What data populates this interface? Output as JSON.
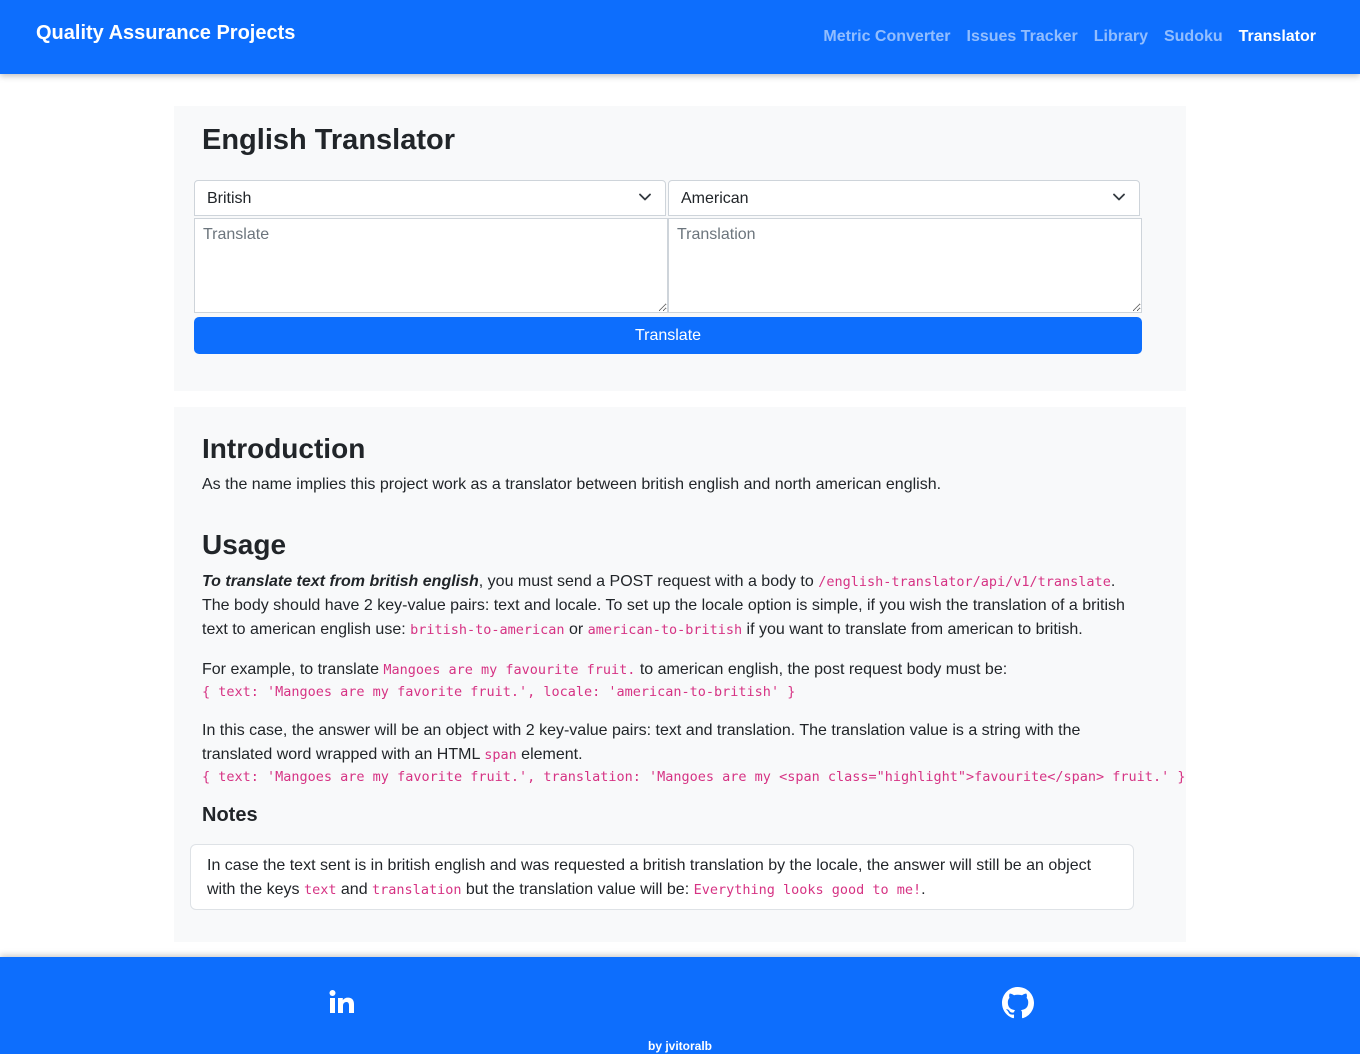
{
  "navbar": {
    "brand": "Quality Assurance Projects",
    "links": [
      "Metric Converter",
      "Issues Tracker",
      "Library",
      "Sudoku",
      "Translator"
    ],
    "active": "Translator"
  },
  "translator": {
    "title": "English Translator",
    "from_locale": "British",
    "to_locale": "American",
    "input_placeholder": "Translate",
    "output_placeholder": "Translation",
    "button_label": "Translate"
  },
  "docs": {
    "intro_title": "Introduction",
    "intro_text": "As the name implies this project work as a translator between british english and north american english.",
    "usage_title": "Usage",
    "usage": {
      "emphasis": "To translate text from british english",
      "t1": ", you must send a POST request with a body to ",
      "endpoint": "/english-translator/api/v1/translate",
      "t2": ". The body should have 2 key-value pairs: text and locale. To set up the locale option is simple, if you wish the translation of a british text to american english use: ",
      "code_b2a": "british-to-american",
      "t3": " or ",
      "code_a2b": "american-to-british",
      "t4": " if you want to translate from american to british."
    },
    "example": {
      "t1": "For example, to translate ",
      "code_sentence": "Mangoes are my favourite fruit.",
      "t2": " to american english, the post request body must be:",
      "code_body": "{ text: 'Mangoes are my favorite fruit.', locale: 'american-to-british' }"
    },
    "answer": {
      "t1": "In this case, the answer will be an object with 2 key-value pairs: text and translation. The translation value is a string with the translated word wrapped with an HTML ",
      "code_span": "span",
      "t2": " element.",
      "code_response": "{ text: 'Mangoes are my favorite fruit.', translation: 'Mangoes are my <span class=\"highlight\">favourite</span> fruit.' }"
    },
    "notes_title": "Notes",
    "notes": {
      "t1": "In case the text sent is in british english and was requested a british translation by the locale, the answer will still be an object with the keys ",
      "code_text": "text",
      "t2": " and ",
      "code_translation": "translation",
      "t3": " but the translation value will be: ",
      "code_message": "Everything looks good to me!",
      "t4": "."
    }
  },
  "footer": {
    "linkedin_icon": "linkedin-icon",
    "github_icon": "github-icon",
    "credit": "by jvitoralb"
  },
  "colors": {
    "primary": "#0d6efd",
    "code": "#d63384",
    "card_bg": "#f8f9fa"
  }
}
